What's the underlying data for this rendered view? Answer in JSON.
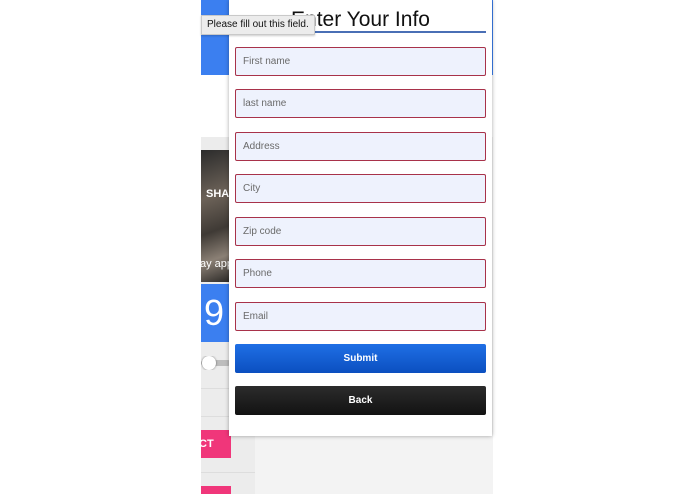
{
  "form": {
    "title": "Enter Your Info",
    "fields": [
      {
        "name": "first-name",
        "placeholder": "First name",
        "value": ""
      },
      {
        "name": "last-name",
        "placeholder": "last name",
        "value": ""
      },
      {
        "name": "address",
        "placeholder": "Address",
        "value": ""
      },
      {
        "name": "city",
        "placeholder": "City",
        "value": ""
      },
      {
        "name": "zip-code",
        "placeholder": "Zip code",
        "value": ""
      },
      {
        "name": "phone",
        "placeholder": "Phone",
        "value": ""
      },
      {
        "name": "email",
        "placeholder": "Email",
        "value": ""
      }
    ],
    "submit_label": "Submit",
    "back_label": "Back"
  },
  "tooltip": {
    "text": "Please fill out this field."
  },
  "background_app": {
    "photo_text_top": "SHA",
    "photo_text_bottom": "ay app",
    "number": "9",
    "pink_button_label": "CT"
  },
  "colors": {
    "accent_blue": "#1f6fe5",
    "header_blue": "#3b7ff0",
    "field_border": "#a8324a",
    "field_background": "#eef2fd",
    "pink": "#f0367a"
  }
}
